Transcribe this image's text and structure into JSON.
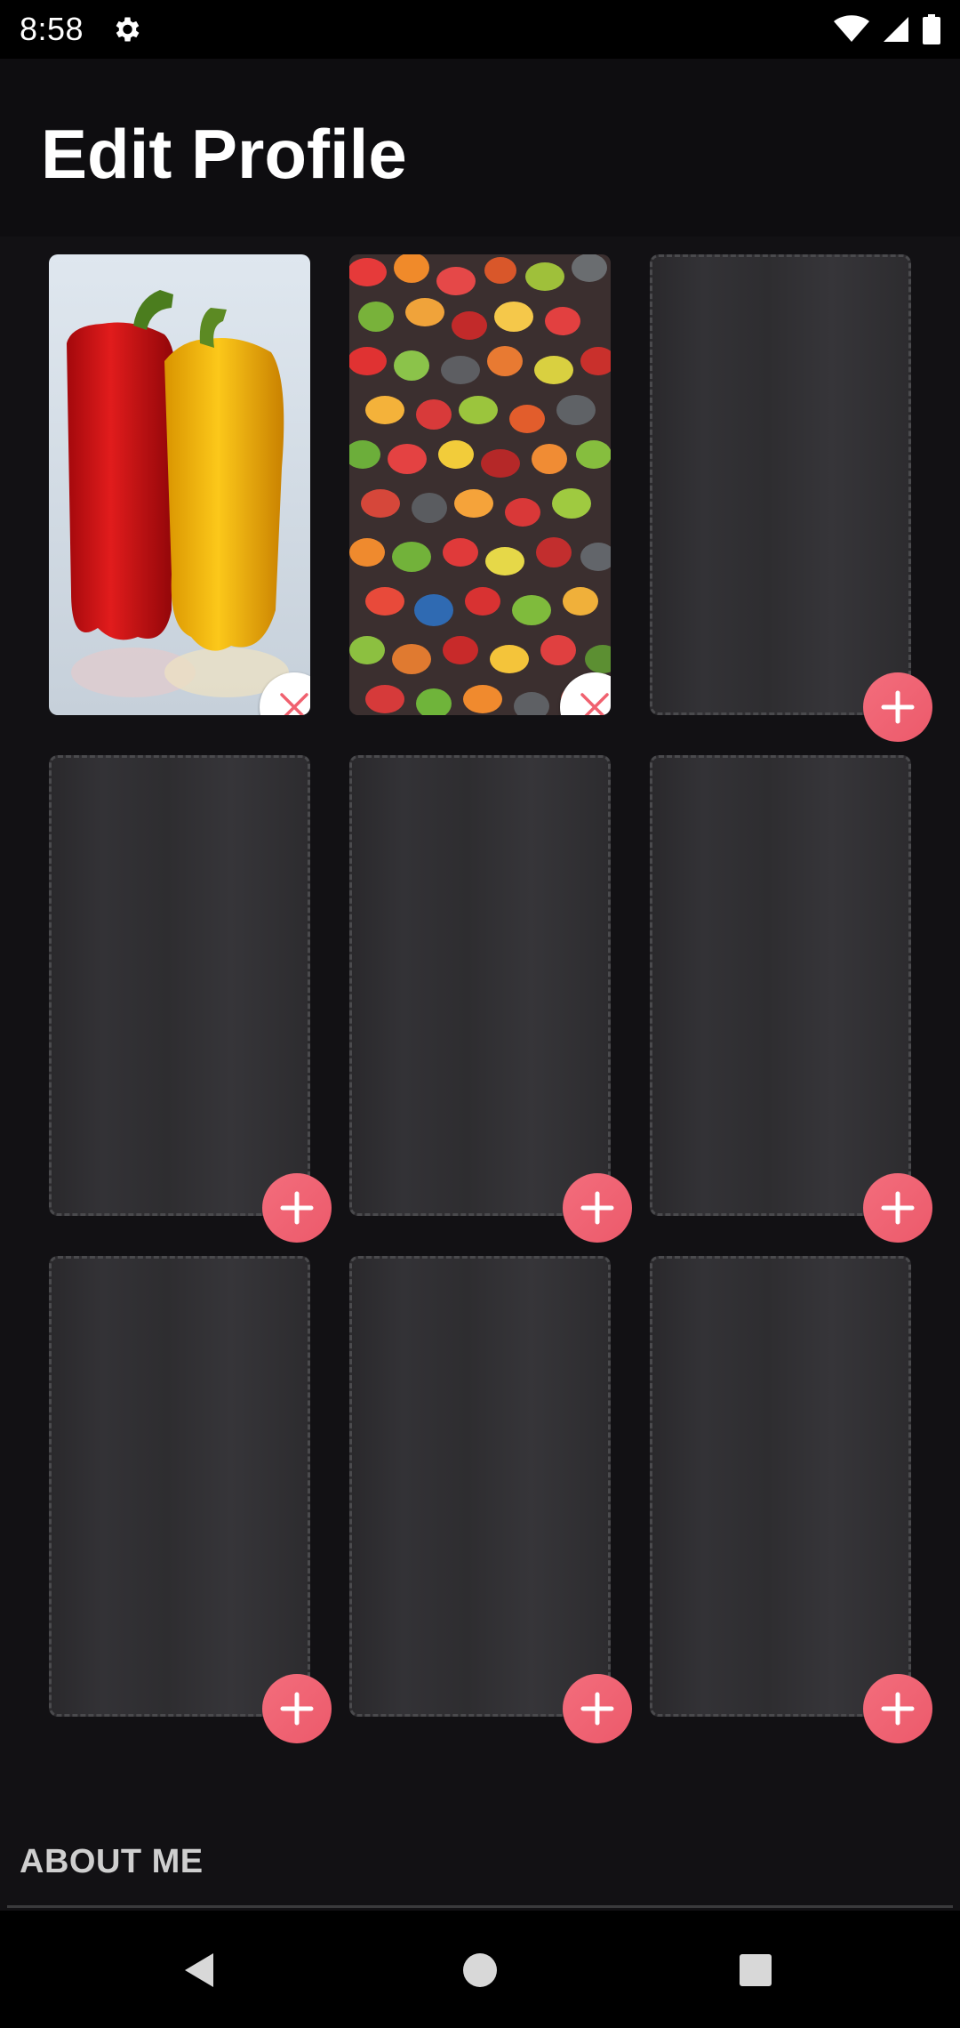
{
  "status_bar": {
    "time": "8:58",
    "icons": [
      "gear-icon",
      "wifi-icon",
      "cell-signal-icon",
      "battery-icon"
    ]
  },
  "header": {
    "title": "Edit Profile"
  },
  "photos": {
    "accent_color": "#f0616f",
    "slots": [
      {
        "state": "filled",
        "image": "red and yellow bell peppers",
        "action_icon": "close-icon"
      },
      {
        "state": "filled",
        "image": "assorted jelly beans",
        "action_icon": "close-icon"
      },
      {
        "state": "empty",
        "action_icon": "plus-icon"
      },
      {
        "state": "empty",
        "action_icon": "plus-icon"
      },
      {
        "state": "empty",
        "action_icon": "plus-icon"
      },
      {
        "state": "empty",
        "action_icon": "plus-icon"
      },
      {
        "state": "empty",
        "action_icon": "plus-icon"
      },
      {
        "state": "empty",
        "action_icon": "plus-icon"
      },
      {
        "state": "empty",
        "action_icon": "plus-icon"
      }
    ]
  },
  "about": {
    "label": "ABOUT ME"
  },
  "nav_bar": {
    "icons": [
      "back-icon",
      "home-icon",
      "recents-icon"
    ]
  }
}
